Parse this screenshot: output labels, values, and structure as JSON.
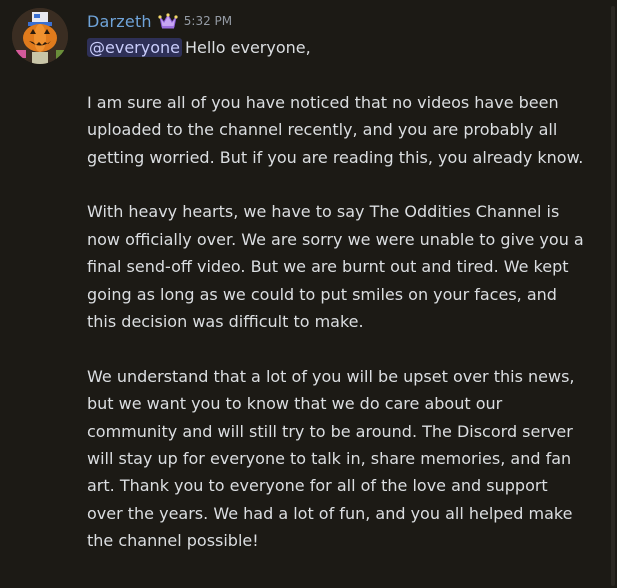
{
  "message": {
    "username": "Darzeth",
    "username_color": "#6fa3d8",
    "badge_icon": "crown-icon",
    "timestamp": "5:32 PM",
    "avatar_icon": "pumpkin-avatar-icon",
    "mention": "@everyone",
    "greeting": "Hello everyone,",
    "paragraphs": [
      "I am sure all of you have noticed that no videos have been uploaded to the channel recently, and you are probably all getting worried. But if you are reading this, you already know.",
      "With heavy hearts, we have to say The Oddities Channel is now officially over. We are sorry we were unable to give you a final send-off video. But we are burnt out and tired. We kept going as long as we could to put smiles on your faces, and this decision was difficult to make.",
      "We understand that a lot of you will be upset over this news, but we want you to know that we do care about our community and will still try to be around. The Discord server will stay up for everyone to talk in, share memories, and fan art. Thank you to everyone for all of the love and support over the years. We had a lot of fun, and you all helped make the channel possible!"
    ]
  }
}
